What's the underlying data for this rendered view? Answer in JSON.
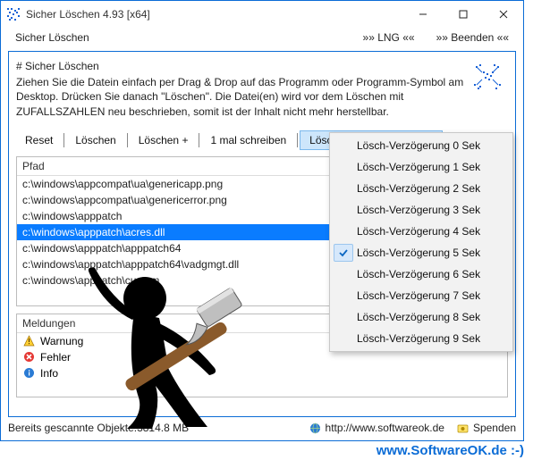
{
  "window": {
    "title": "Sicher Löschen 4.93 [x64]"
  },
  "menubar": {
    "main": "Sicher Löschen",
    "lang": "»» LNG ««",
    "exit": "»» Beenden ««"
  },
  "info": {
    "heading": "# Sicher Löschen",
    "body": "Ziehen Sie die Datein einfach per Drag & Drop auf das Programm oder Programm-Symbol am Desktop. Drücken Sie danach \"Löschen\". Die Datei(en) wird vor dem Löschen mit ZUFALLSZAHLEN neu beschrieben, somit ist der Inhalt nicht mehr herstellbar."
  },
  "toolbar": {
    "reset": "Reset",
    "delete": "Löschen",
    "delete_plus": "Löschen +",
    "write_once": "1 mal schreiben",
    "delay_active": "Lösch-Verzögerung 5 Sek"
  },
  "list": {
    "header": "Pfad",
    "rows": [
      "c:\\windows\\appcompat\\ua\\genericapp.png",
      "c:\\windows\\appcompat\\ua\\genericerror.png",
      "c:\\windows\\apppatch",
      "c:\\windows\\apppatch\\acres.dll",
      "c:\\windows\\apppatch\\apppatch64",
      "c:\\windows\\apppatch\\apppatch64\\vadgmgt.dll",
      "c:\\windows\\apppatch\\custom"
    ],
    "selected_index": 3
  },
  "messages": {
    "header": "Meldungen",
    "items": [
      {
        "icon": "warning",
        "label": "Warnung"
      },
      {
        "icon": "error",
        "label": "Fehler"
      },
      {
        "icon": "info",
        "label": "Info"
      }
    ]
  },
  "status": {
    "scanned": "Bereits gescannte Objekte:3814.8 MB",
    "url": "http://www.softwareok.de",
    "donate": "Spenden"
  },
  "dropdown": {
    "items": [
      "Lösch-Verzögerung 0 Sek",
      "Lösch-Verzögerung 1 Sek",
      "Lösch-Verzögerung 2 Sek",
      "Lösch-Verzögerung 3 Sek",
      "Lösch-Verzögerung 4 Sek",
      "Lösch-Verzögerung 5 Sek",
      "Lösch-Verzögerung 6 Sek",
      "Lösch-Verzögerung 7 Sek",
      "Lösch-Verzögerung 8 Sek",
      "Lösch-Verzögerung 9 Sek"
    ],
    "checked_index": 5
  },
  "watermark": "www.SoftwareOK.de :-)"
}
